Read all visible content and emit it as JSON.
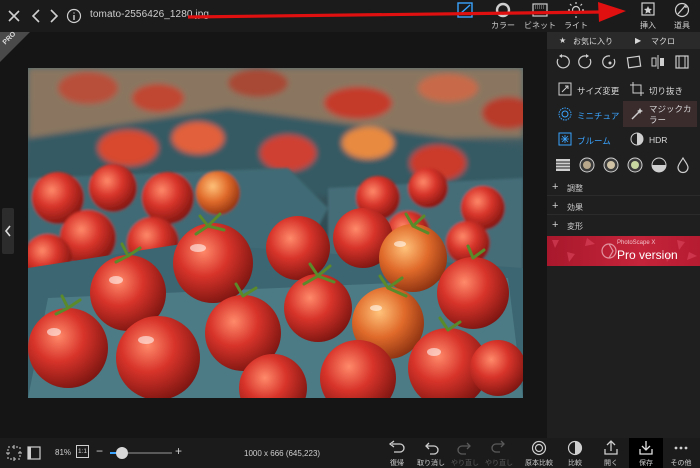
{
  "file": {
    "name": "tomato-2556426_1280.jpg"
  },
  "topbar": {
    "tools": [
      {
        "label": "",
        "icon": "adjust-icon"
      },
      {
        "label": "カラー",
        "icon": "color-icon"
      },
      {
        "label": "ビネット",
        "icon": "vignette-icon"
      },
      {
        "label": "ライト",
        "icon": "light-icon"
      },
      {
        "label": "挿入",
        "icon": "insert-icon"
      },
      {
        "label": "道具",
        "icon": "tools-icon"
      }
    ]
  },
  "canvas": {
    "pro_badge": "PRO"
  },
  "panel": {
    "favorites_label": "お気に入り",
    "macro_label": "マクロ",
    "menu": {
      "resize": "サイズ変更",
      "crop": "切り抜き",
      "miniature": "ミニチュア",
      "magic_color_line1": "マジックカ",
      "magic_color_line2": "ラー",
      "bloom": "ブルーム",
      "hdr": "HDR"
    },
    "sections": [
      "調整",
      "効果",
      "変形"
    ],
    "banner": {
      "small": "PhotoScape X",
      "title": "Pro version"
    }
  },
  "bottombar": {
    "zoom": "81%",
    "zoom_fit": "1:1",
    "zoom_level": 0.2,
    "dimensions": "1000 x 666 (645,223)",
    "buttons": [
      {
        "label": "復帰",
        "icon": "revert-icon",
        "disabled": false
      },
      {
        "label": "取り消し",
        "icon": "undo-icon",
        "disabled": false
      },
      {
        "label": "やり直し",
        "icon": "redo-icon",
        "disabled": true
      },
      {
        "label": "やり直し",
        "icon": "redo-all-icon",
        "disabled": true
      },
      {
        "label": "原本比較",
        "icon": "compare-original-icon",
        "disabled": false
      },
      {
        "label": "比較",
        "icon": "compare-icon",
        "disabled": false
      },
      {
        "label": "開く",
        "icon": "open-icon",
        "disabled": false
      },
      {
        "label": "保存",
        "icon": "save-icon",
        "disabled": false
      },
      {
        "label": "その他",
        "icon": "more-icon",
        "disabled": false
      }
    ]
  },
  "colors": {
    "accent": "#3aa4ff",
    "arrow": "#e01010",
    "banner": "#c5243a"
  }
}
